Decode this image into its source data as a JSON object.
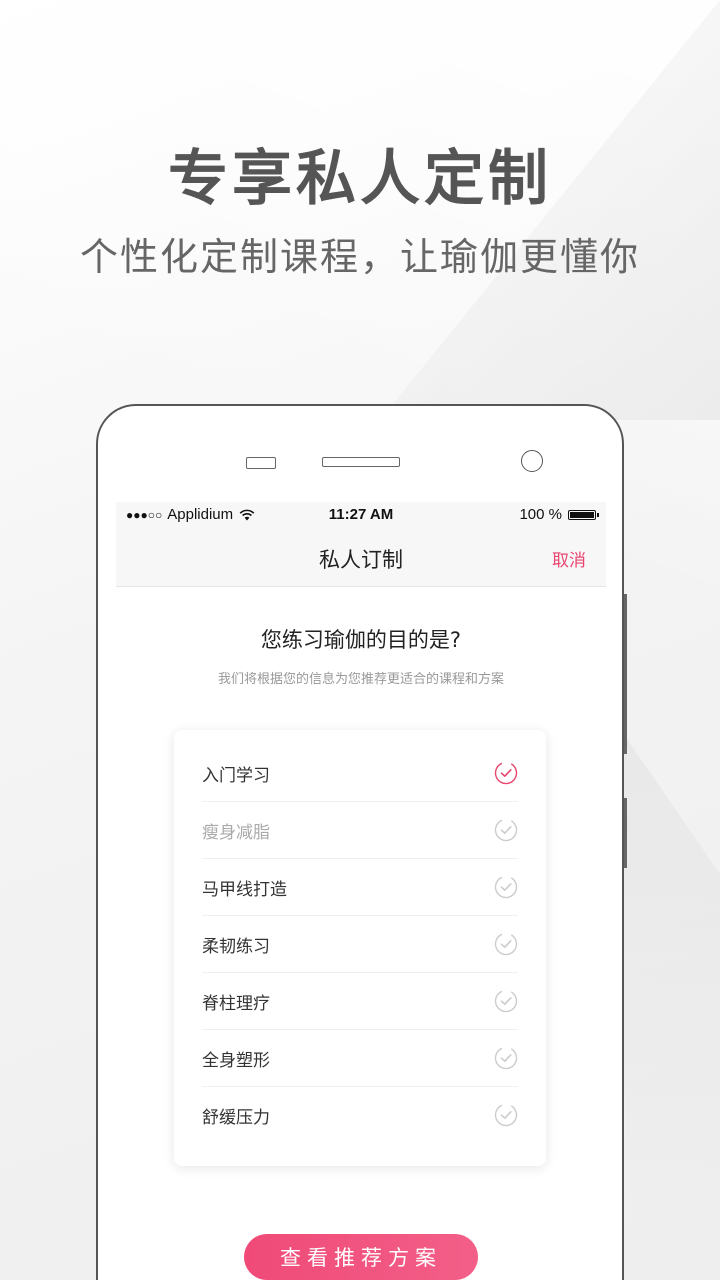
{
  "hero": {
    "title": "专享私人定制",
    "subtitle": "个性化定制课程，让瑜伽更懂你"
  },
  "status_bar": {
    "signal": "●●●○○",
    "carrier": "Applidium",
    "time": "11:27 AM",
    "battery": "100 %",
    "wifi_icon": "wifi-icon",
    "battery_icon": "battery-icon"
  },
  "nav": {
    "title": "私人订制",
    "cancel_label": "取消"
  },
  "question": {
    "title": "您练习瑜伽的目的是?",
    "hint": "我们将根据您的信息为您推荐更适合的课程和方案"
  },
  "options": [
    {
      "label": "入门学习",
      "selected": true
    },
    {
      "label": "瘦身减脂",
      "selected": false
    },
    {
      "label": "马甲线打造",
      "selected": false
    },
    {
      "label": "柔韧练习",
      "selected": false
    },
    {
      "label": "脊柱理疗",
      "selected": false
    },
    {
      "label": "全身塑形",
      "selected": false
    },
    {
      "label": "舒缓压力",
      "selected": false
    }
  ],
  "cta": {
    "label": "查看推荐方案"
  },
  "colors": {
    "accent": "#e8456f",
    "unchecked": "#cccccc",
    "headline": "#555555"
  }
}
